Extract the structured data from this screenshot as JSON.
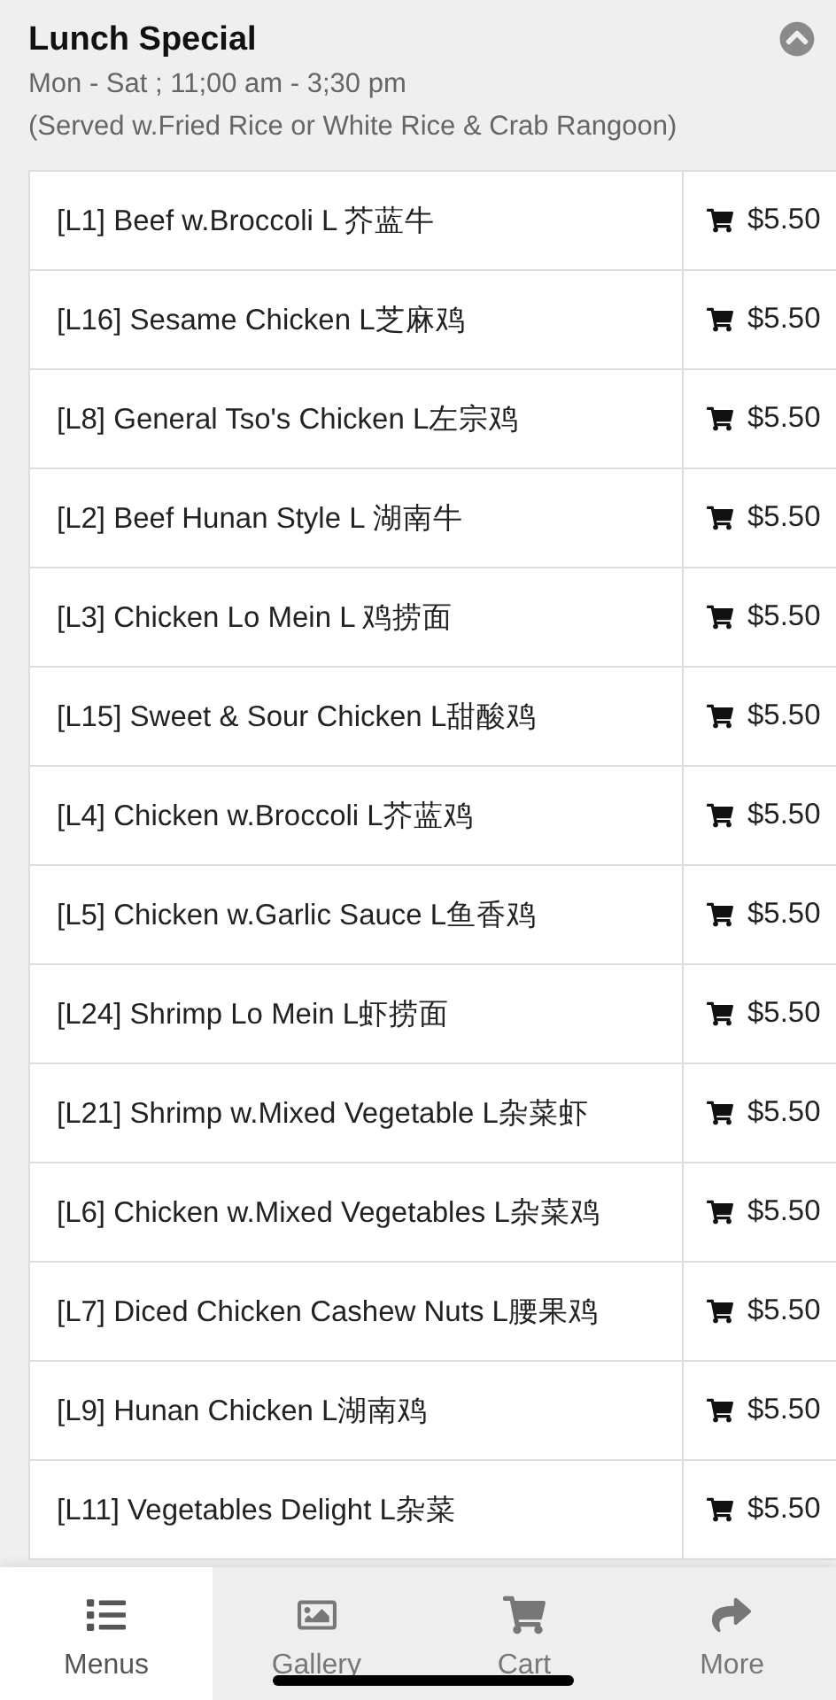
{
  "section": {
    "title": "Lunch Special",
    "hours": "Mon - Sat ; 11;00 am - 3;30 pm",
    "note": "(Served w.Fried Rice or White Rice & Crab Rangoon)",
    "expanded": true
  },
  "items": [
    {
      "name": "[L1] Beef w.Broccoli L 芥蓝牛",
      "price": "$5.50"
    },
    {
      "name": "[L16] Sesame Chicken L芝麻鸡",
      "price": "$5.50"
    },
    {
      "name": "[L8] General Tso's Chicken L左宗鸡",
      "price": "$5.50"
    },
    {
      "name": "[L2] Beef Hunan Style L 湖南牛",
      "price": "$5.50"
    },
    {
      "name": "[L3] Chicken Lo Mein L 鸡捞面",
      "price": "$5.50"
    },
    {
      "name": "[L15] Sweet & Sour Chicken L甜酸鸡",
      "price": "$5.50"
    },
    {
      "name": "[L4] Chicken w.Broccoli L芥蓝鸡",
      "price": "$5.50"
    },
    {
      "name": "[L5] Chicken w.Garlic Sauce L鱼香鸡",
      "price": "$5.50"
    },
    {
      "name": "[L24] Shrimp Lo Mein L虾捞面",
      "price": "$5.50"
    },
    {
      "name": "[L21] Shrimp w.Mixed Vegetable L杂菜虾",
      "price": "$5.50"
    },
    {
      "name": "[L6] Chicken w.Mixed Vegetables L杂菜鸡",
      "price": "$5.50"
    },
    {
      "name": "[L7] Diced Chicken Cashew Nuts L腰果鸡",
      "price": "$5.50"
    },
    {
      "name": "[L9] Hunan Chicken L湖南鸡",
      "price": "$5.50"
    },
    {
      "name": "[L11] Vegetables Delight L杂菜",
      "price": "$5.50"
    }
  ],
  "tabs": [
    {
      "label": "Menus",
      "kind": "list",
      "selected": true
    },
    {
      "label": "Gallery",
      "kind": "image",
      "selected": false
    },
    {
      "label": "Cart",
      "kind": "cart",
      "selected": false
    },
    {
      "label": "More",
      "kind": "share",
      "selected": false
    }
  ]
}
